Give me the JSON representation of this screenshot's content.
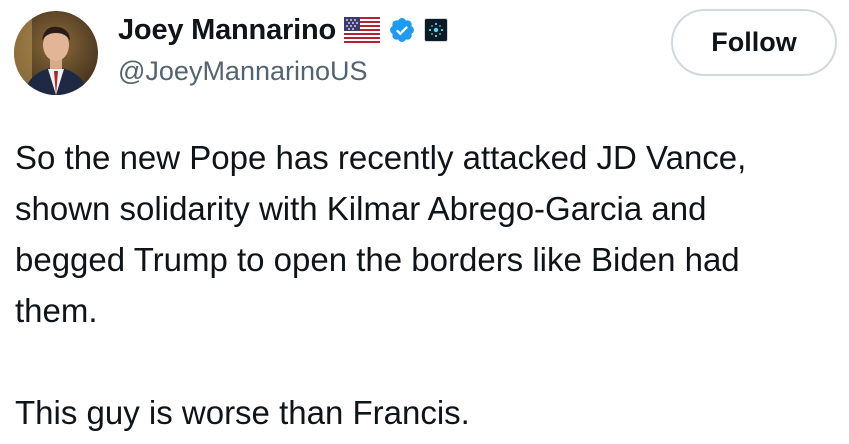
{
  "author": {
    "display_name": "Joey Mannarino",
    "handle": "@JoeyMannarinoUS",
    "badges": [
      "us-flag-icon",
      "verified-check-icon",
      "affiliate-badge-icon"
    ]
  },
  "actions": {
    "follow_label": "Follow"
  },
  "tweet": {
    "lines": [
      "So the new Pope has recently attacked JD Vance,",
      "shown solidarity with Kilmar Abrego-Garcia and",
      "begged Trump to open the borders like Biden had",
      "them.",
      "This guy is worse than Francis."
    ]
  },
  "colors": {
    "text_primary": "#0f1419",
    "text_secondary": "#536471",
    "verified_blue": "#1d9bf0",
    "button_border": "#cfd9de"
  }
}
